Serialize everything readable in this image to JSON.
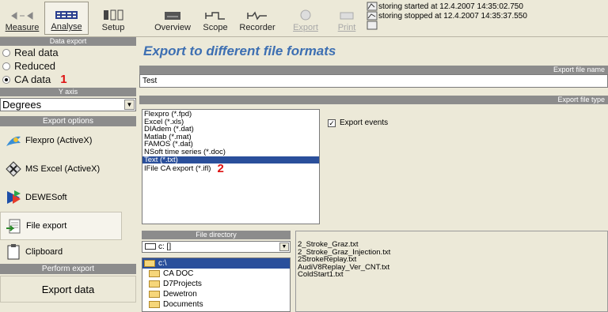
{
  "toolbar": {
    "buttons": [
      {
        "label": "Measure",
        "icon": "measure-icon"
      },
      {
        "label": "Analyse",
        "icon": "analyse-icon"
      },
      {
        "label": "Setup",
        "icon": "setup-icon"
      },
      {
        "label": "Overview",
        "icon": "overview-icon"
      },
      {
        "label": "Scope",
        "icon": "scope-icon"
      },
      {
        "label": "Recorder",
        "icon": "recorder-icon"
      },
      {
        "label": "Export",
        "icon": "export-icon"
      },
      {
        "label": "Print",
        "icon": "print-icon"
      }
    ],
    "status_line1": "storing started at 12.4.2007 14:35:02.750",
    "status_line2": "storing stopped at 12.4.2007 14:35:37.550"
  },
  "left": {
    "data_export_header": "Data export",
    "radios": [
      {
        "label": "Real data",
        "checked": false
      },
      {
        "label": "Reduced",
        "checked": false
      },
      {
        "label": "CA data",
        "checked": true
      }
    ],
    "marker1": "1",
    "y_axis_header": "Y axis",
    "y_axis_value": "Degrees",
    "export_options_header": "Export options",
    "options": [
      {
        "label": "Flexpro (ActiveX)",
        "icon": "flexpro-icon"
      },
      {
        "label": "MS Excel (ActiveX)",
        "icon": "excel-icon"
      },
      {
        "label": "DEWESoft",
        "icon": "dewesoft-icon"
      },
      {
        "label": "File export",
        "icon": "file-export-icon"
      },
      {
        "label": "Clipboard",
        "icon": "clipboard-icon"
      }
    ],
    "perform_header": "Perform export",
    "export_button": "Export data"
  },
  "main": {
    "title": "Export to different file formats",
    "file_name_header": "Export file name",
    "file_name_value": "Test",
    "file_type_header": "Export file type",
    "file_types": [
      "Flexpro (*.fpd)",
      "Excel (*.xls)",
      "DIAdem (*.dat)",
      "Matlab (*.mat)",
      "FAMOS (*.dat)",
      "NSoft time series (*.doc)",
      "Text (*.txt)",
      "IFile CA export (*.ifl)"
    ],
    "selected_type_index": 6,
    "marker2": "2",
    "export_events_label": "Export events",
    "export_events_checked": true,
    "file_directory_header": "File directory",
    "drive_value": "c: []",
    "folders": [
      "c:\\",
      "CA DOC",
      "D7Projects",
      "Dewetron",
      "Documents"
    ],
    "files": [
      "2_Stroke_Graz.txt",
      "2_Stroke_Graz_Injection.txt",
      "2StrokeReplay.txt",
      "AudiV8Replay_Ver_CNT.txt",
      "ColdStart1.txt"
    ]
  }
}
